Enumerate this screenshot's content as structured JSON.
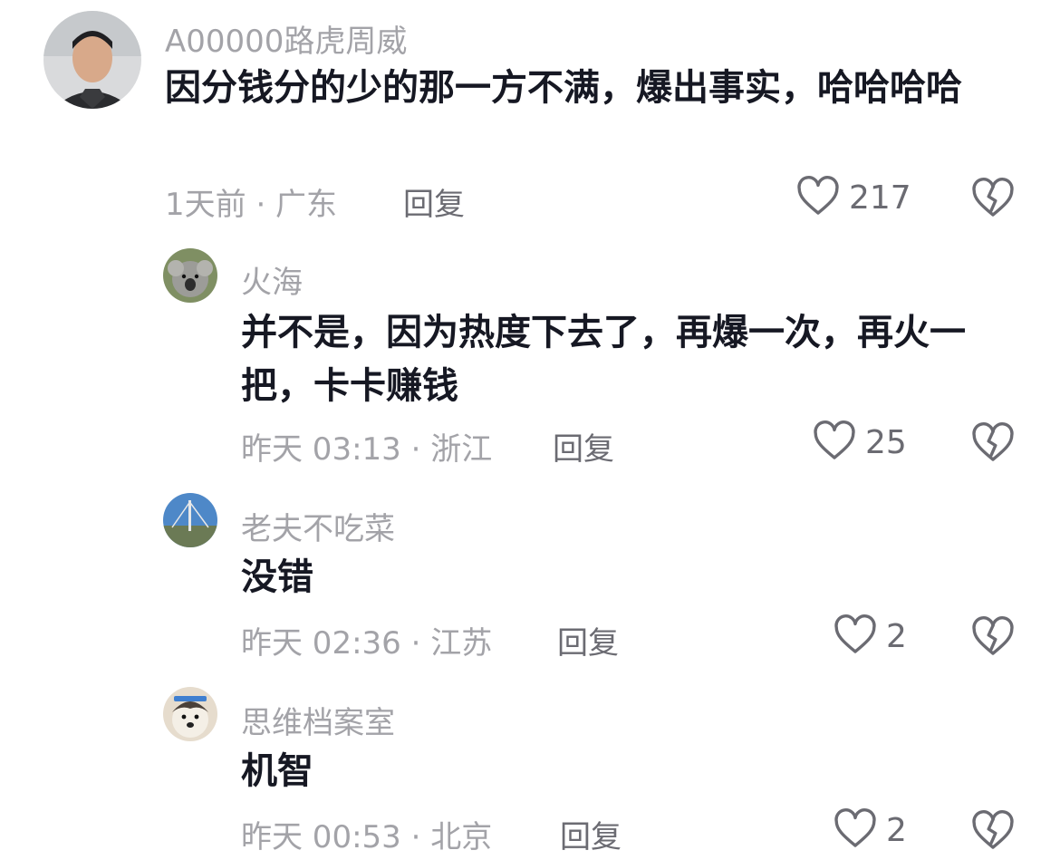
{
  "comments": [
    {
      "username": "A00000路虎周威",
      "text": "因分钱分的少的那一方不满，爆出事实，哈哈哈哈",
      "time": "1天前 · 广东",
      "reply_label": "回复",
      "likes": "217"
    },
    {
      "username": "火海",
      "text": "并不是，因为热度下去了，再爆一次，再火一把，卡卡赚钱",
      "time": "昨天 03:13 · 浙江",
      "reply_label": "回复",
      "likes": "25"
    },
    {
      "username": "老夫不吃菜",
      "text": "没错",
      "time": "昨天 02:36 · 江苏",
      "reply_label": "回复",
      "likes": "2"
    },
    {
      "username": "思维档案室",
      "text": "机智",
      "time": "昨天 00:53 · 北京",
      "reply_label": "回复",
      "likes": "2"
    }
  ],
  "icons": {
    "like": "heart-outline-icon",
    "dislike": "broken-heart-icon"
  },
  "colors": {
    "username": "#a3a3a8",
    "content": "#161823",
    "meta": "#a3a3a8",
    "action": "#6b6b72"
  }
}
